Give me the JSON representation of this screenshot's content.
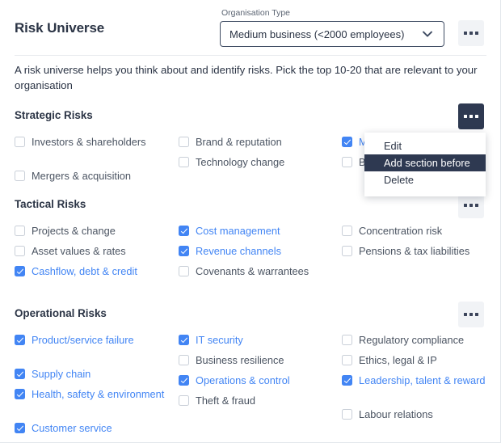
{
  "header": {
    "title": "Risk Universe",
    "org_type_label": "Organisation Type",
    "org_type_value": "Medium business (<2000 employees)",
    "chevron_icon": "chevron-down-icon",
    "kebab_icon": "kebab-menu-icon"
  },
  "intro": "A risk universe helps you think about and identify risks. Pick the top 10-20 that are relevant to your organisation",
  "colors": {
    "accent_blue": "#4285f4",
    "dark_navy": "#2e3951",
    "text": "#2b3445",
    "muted_text": "#4b5462",
    "panel_grey": "#f1f3f6",
    "border": "#e8ebef"
  },
  "context_menu": {
    "visible": true,
    "items": [
      {
        "label": "Edit",
        "active": false
      },
      {
        "label": "Add section before",
        "active": true
      },
      {
        "label": "Delete",
        "active": false
      }
    ]
  },
  "sections": [
    {
      "title": "Strategic Risks",
      "kebab_active": true,
      "columns": [
        [
          {
            "label": "Investors & shareholders",
            "checked": false
          },
          {
            "label": "Mergers & acquisition",
            "checked": false
          }
        ],
        [
          {
            "label": "Brand & reputation",
            "checked": false
          },
          {
            "label": "Technology change",
            "checked": false
          }
        ],
        [
          {
            "label": "M",
            "checked": true
          },
          {
            "label": "B",
            "checked": false
          }
        ]
      ]
    },
    {
      "title": "Tactical Risks",
      "kebab_active": false,
      "columns": [
        [
          {
            "label": "Projects & change",
            "checked": false
          },
          {
            "label": "Asset values & rates",
            "checked": false
          },
          {
            "label": "Cashflow, debt & credit",
            "checked": true
          }
        ],
        [
          {
            "label": "Cost management",
            "checked": true
          },
          {
            "label": "Revenue channels",
            "checked": true
          },
          {
            "label": "Covenants & warrantees",
            "checked": false
          }
        ],
        [
          {
            "label": "Concentration risk",
            "checked": false
          },
          {
            "label": "Pensions & tax liabilities",
            "checked": false
          }
        ]
      ]
    },
    {
      "title": "Operational Risks",
      "kebab_active": false,
      "columns": [
        [
          {
            "label": "Product/service failure",
            "checked": true
          },
          {
            "label": "Supply chain",
            "checked": true
          },
          {
            "label": "Health, safety & environment",
            "checked": true
          },
          {
            "label": "Customer service",
            "checked": true
          }
        ],
        [
          {
            "label": "IT security",
            "checked": true
          },
          {
            "label": "Business resilience",
            "checked": false
          },
          {
            "label": "Operations & control",
            "checked": true
          },
          {
            "label": "Theft & fraud",
            "checked": false
          }
        ],
        [
          {
            "label": "Regulatory compliance",
            "checked": false
          },
          {
            "label": "Ethics, legal & IP",
            "checked": false
          },
          {
            "label": "Leadership, talent & reward",
            "checked": true
          },
          {
            "label": "Labour relations",
            "checked": false
          }
        ]
      ]
    }
  ]
}
